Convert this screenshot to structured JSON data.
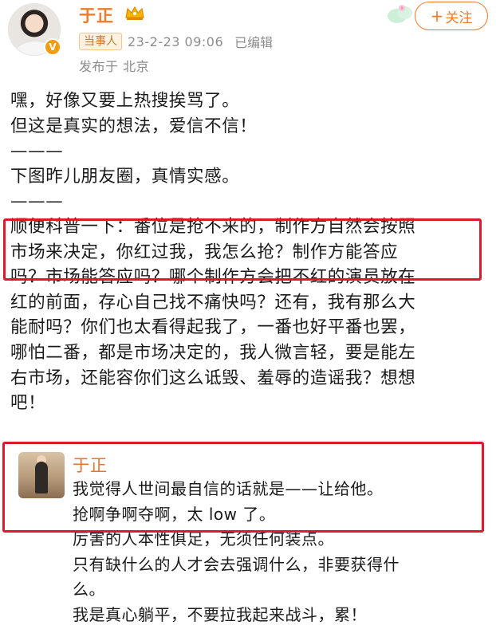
{
  "header": {
    "username": "于正",
    "badge_v": "V",
    "tag": "当事人",
    "timestamp": "23-2-23 09:06",
    "edited": "已编辑",
    "location": "发布于 北京",
    "follow_plus": "+",
    "follow_label": "关注"
  },
  "colors": {
    "accent": "#ef7a2a",
    "highlight_box": "#e0182d",
    "meta_gray": "#8c8c8c"
  },
  "post": {
    "lines": [
      "嘿，好像又要上热搜挨骂了。",
      "但这是真实的想法，爱信不信！",
      "———",
      "下图昨儿朋友圈，真情实感。",
      "———",
      "顺便科普一下：番位是抢不来的，制作方自然会按照",
      "市场来决定，你红过我，我怎么抢？制作方能答应",
      "吗？市场能答应吗？哪个制作方会把不红的演员放在",
      "红的前面，存心自己找不痛快吗？还有，我有那么大",
      "能耐吗？你们也太看得起我了，一番也好平番也罢，",
      "哪怕二番，都是市场决定的，我人微言轻，要是能左",
      "右市场，还能容你们这么诋毁、羞辱的造谣我？想想",
      "吧！"
    ]
  },
  "quote": {
    "name": "于正",
    "lines": [
      "我觉得人世间最自信的话就是——让给他。",
      "抢啊争啊夺啊，太 low 了。",
      "厉害的人本性俱足，无须任何装点。",
      "只有缺什么的人才会去强调什么，非要获得什",
      "么。",
      "我是真心躺平，不要拉我起来战斗，累！"
    ]
  }
}
